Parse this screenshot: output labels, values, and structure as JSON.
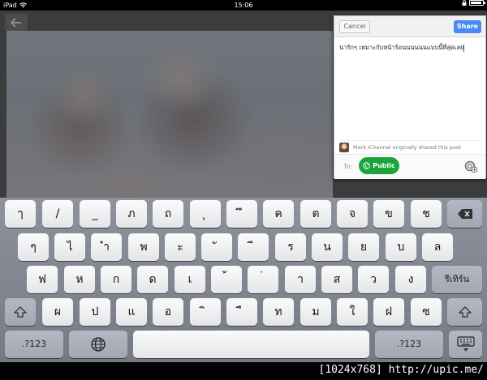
{
  "status_bar": {
    "device": "iPad",
    "time": "15:06"
  },
  "share_dialog": {
    "cancel_label": "Cancel",
    "share_label": "Share",
    "post_text": "น่ารักๆ เหมาะกับหน้าร้อนนนนนนแบบนี้ที่สุดเลย",
    "origin_text": "Mark iChannel originally shared this post",
    "to_label": "To:",
    "audience_label": "Public"
  },
  "keyboard": {
    "row1": [
      "ๅ",
      "/",
      "_",
      "ภ",
      "ถ",
      "ุ",
      "ึ",
      "ค",
      "ต",
      "จ",
      "ข",
      "ช"
    ],
    "row2": [
      "ๆ",
      "ไ",
      "ำ",
      "พ",
      "ะ",
      "ั",
      "ี",
      "ร",
      "น",
      "ย",
      "บ",
      "ล"
    ],
    "row3": [
      "ฟ",
      "ห",
      "ก",
      "ด",
      "เ",
      "้",
      "่",
      "า",
      "ส",
      "ว",
      "ง"
    ],
    "row3_action": "รีเทิร์น",
    "row4": [
      "ผ",
      "ป",
      "แ",
      "อ",
      "ิ",
      "ื",
      "ท",
      "ม",
      "ใ",
      "ฝ",
      "ซ"
    ],
    "numbers_left": ".?123",
    "numbers_right": ".?123",
    "icons": {
      "delete": "backspace-icon",
      "shift": "shift-icon",
      "globe": "globe-icon",
      "hide": "keyboard-hide-icon"
    }
  },
  "footer": {
    "watermark": "[1024x768] http://upic.me/"
  },
  "colors": {
    "share_blue": "#4a8af4",
    "public_green": "#1aa43b",
    "keyboard_bg": "#80858f"
  }
}
